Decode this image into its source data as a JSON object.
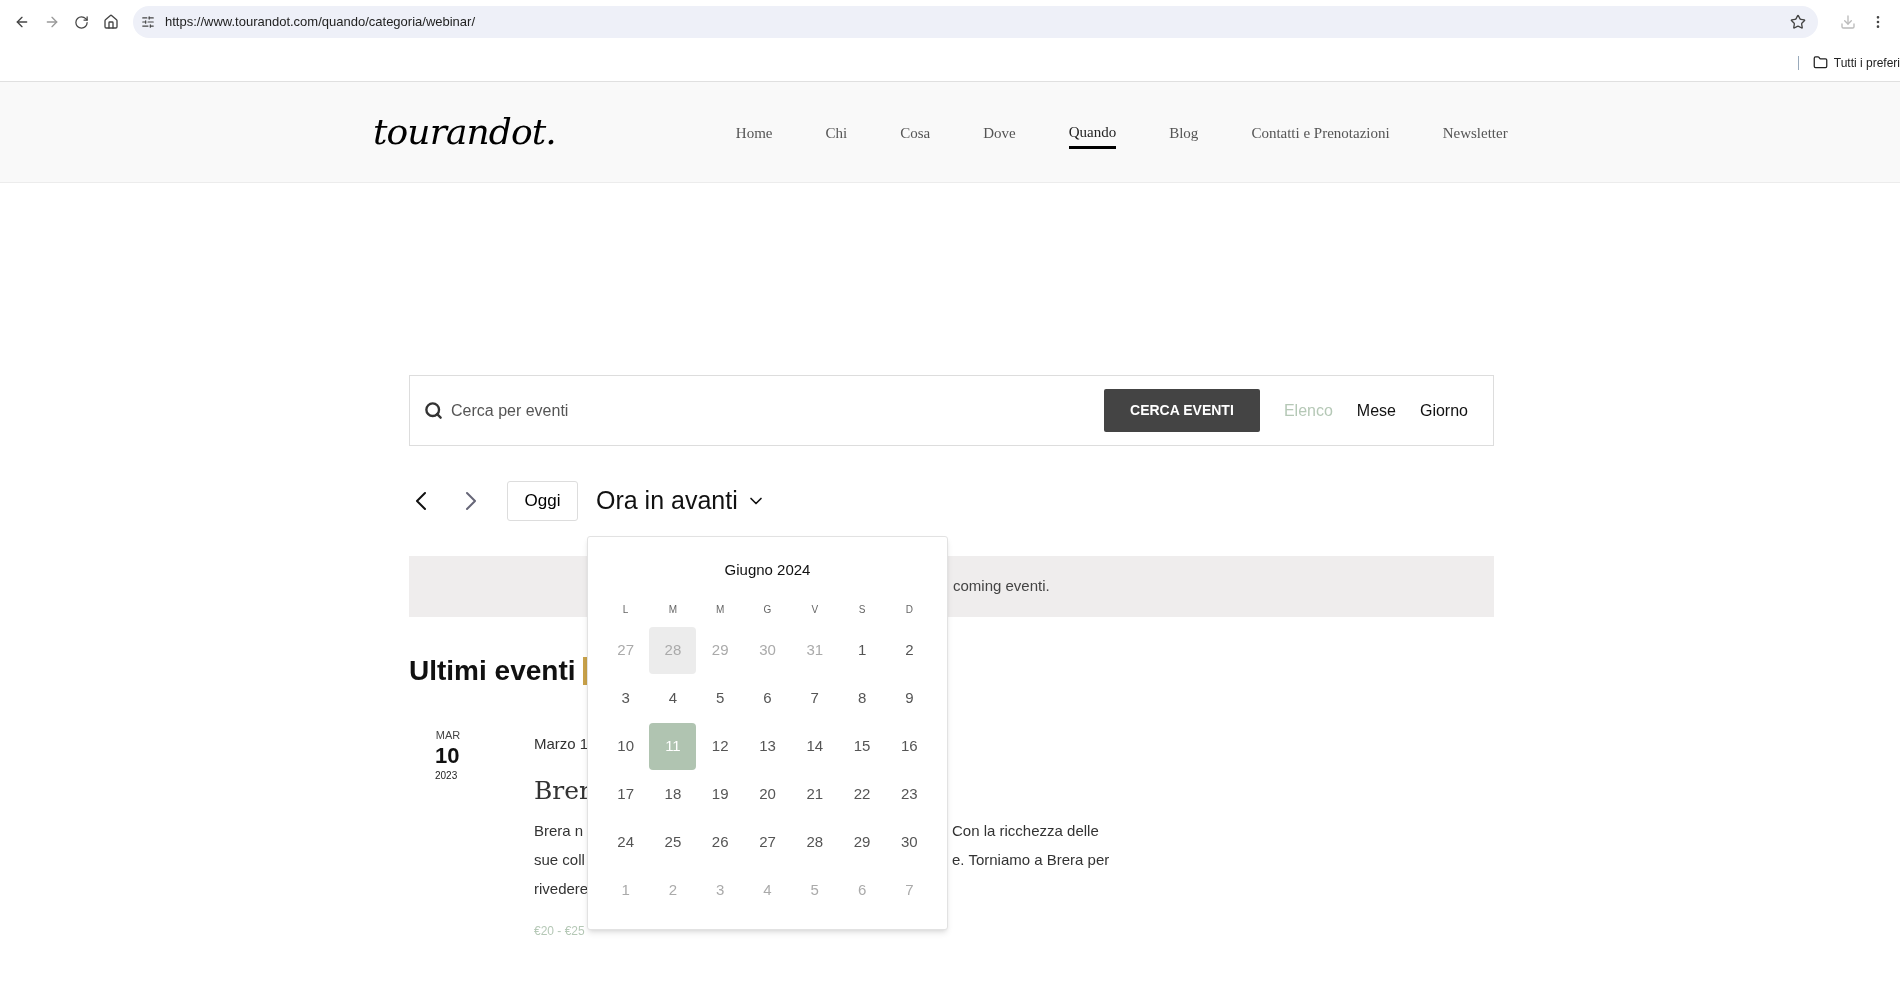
{
  "browser": {
    "url": "https://www.tourandot.com/quando/categoria/webinar/",
    "bookmarks_folder": "Tutti i preferi"
  },
  "header": {
    "logo": "tourandot.",
    "nav": [
      {
        "label": "Home",
        "selected": false
      },
      {
        "label": "Chi",
        "selected": false
      },
      {
        "label": "Cosa",
        "selected": false
      },
      {
        "label": "Dove",
        "selected": false
      },
      {
        "label": "Quando",
        "selected": true
      },
      {
        "label": "Blog",
        "selected": false
      },
      {
        "label": "Contatti e Prenotazioni",
        "selected": false
      },
      {
        "label": "Newsletter",
        "selected": false
      }
    ]
  },
  "search": {
    "placeholder": "Cerca per eventi",
    "button": "CERCA EVENTI",
    "views": [
      {
        "label": "Elenco",
        "selected": true
      },
      {
        "label": "Mese",
        "selected": false
      },
      {
        "label": "Giorno",
        "selected": false
      }
    ]
  },
  "toolbar": {
    "today": "Oggi",
    "range": "Ora in avanti"
  },
  "notice": "coming eventi.",
  "calendar": {
    "title": "Giugno 2024",
    "weekdays": [
      "L",
      "M",
      "M",
      "G",
      "V",
      "S",
      "D"
    ],
    "weeks": [
      [
        {
          "label": "27",
          "muted": true,
          "hovered": false,
          "selected": false
        },
        {
          "label": "28",
          "muted": true,
          "hovered": true,
          "selected": false
        },
        {
          "label": "29",
          "muted": true,
          "hovered": false,
          "selected": false
        },
        {
          "label": "30",
          "muted": true,
          "hovered": false,
          "selected": false
        },
        {
          "label": "31",
          "muted": true,
          "hovered": false,
          "selected": false
        },
        {
          "label": "1",
          "muted": false,
          "hovered": false,
          "selected": false
        },
        {
          "label": "2",
          "muted": false,
          "hovered": false,
          "selected": false
        }
      ],
      [
        {
          "label": "3",
          "muted": false,
          "hovered": false,
          "selected": false
        },
        {
          "label": "4",
          "muted": false,
          "hovered": false,
          "selected": false
        },
        {
          "label": "5",
          "muted": false,
          "hovered": false,
          "selected": false
        },
        {
          "label": "6",
          "muted": false,
          "hovered": false,
          "selected": false
        },
        {
          "label": "7",
          "muted": false,
          "hovered": false,
          "selected": false
        },
        {
          "label": "8",
          "muted": false,
          "hovered": false,
          "selected": false
        },
        {
          "label": "9",
          "muted": false,
          "hovered": false,
          "selected": false
        }
      ],
      [
        {
          "label": "10",
          "muted": false,
          "hovered": false,
          "selected": false
        },
        {
          "label": "11",
          "muted": false,
          "hovered": false,
          "selected": true
        },
        {
          "label": "12",
          "muted": false,
          "hovered": false,
          "selected": false
        },
        {
          "label": "13",
          "muted": false,
          "hovered": false,
          "selected": false
        },
        {
          "label": "14",
          "muted": false,
          "hovered": false,
          "selected": false
        },
        {
          "label": "15",
          "muted": false,
          "hovered": false,
          "selected": false
        },
        {
          "label": "16",
          "muted": false,
          "hovered": false,
          "selected": false
        }
      ],
      [
        {
          "label": "17",
          "muted": false,
          "hovered": false,
          "selected": false
        },
        {
          "label": "18",
          "muted": false,
          "hovered": false,
          "selected": false
        },
        {
          "label": "19",
          "muted": false,
          "hovered": false,
          "selected": false
        },
        {
          "label": "20",
          "muted": false,
          "hovered": false,
          "selected": false
        },
        {
          "label": "21",
          "muted": false,
          "hovered": false,
          "selected": false
        },
        {
          "label": "22",
          "muted": false,
          "hovered": false,
          "selected": false
        },
        {
          "label": "23",
          "muted": false,
          "hovered": false,
          "selected": false
        }
      ],
      [
        {
          "label": "24",
          "muted": false,
          "hovered": false,
          "selected": false
        },
        {
          "label": "25",
          "muted": false,
          "hovered": false,
          "selected": false
        },
        {
          "label": "26",
          "muted": false,
          "hovered": false,
          "selected": false
        },
        {
          "label": "27",
          "muted": false,
          "hovered": false,
          "selected": false
        },
        {
          "label": "28",
          "muted": false,
          "hovered": false,
          "selected": false
        },
        {
          "label": "29",
          "muted": false,
          "hovered": false,
          "selected": false
        },
        {
          "label": "30",
          "muted": false,
          "hovered": false,
          "selected": false
        }
      ],
      [
        {
          "label": "1",
          "muted": true,
          "hovered": false,
          "selected": false
        },
        {
          "label": "2",
          "muted": true,
          "hovered": false,
          "selected": false
        },
        {
          "label": "3",
          "muted": true,
          "hovered": false,
          "selected": false
        },
        {
          "label": "4",
          "muted": true,
          "hovered": false,
          "selected": false
        },
        {
          "label": "5",
          "muted": true,
          "hovered": false,
          "selected": false
        },
        {
          "label": "6",
          "muted": true,
          "hovered": false,
          "selected": false
        },
        {
          "label": "7",
          "muted": true,
          "hovered": false,
          "selected": false
        }
      ]
    ]
  },
  "section_title": "Ultimi eventi",
  "event": {
    "month": "MAR",
    "day": "10",
    "year": "2023",
    "date": "Marzo 1",
    "title": "Brer",
    "lines": [
      {
        "left": "Brera n",
        "right": "Con la ricchezza delle"
      },
      {
        "left": "sue coll",
        "right": "e. Torniamo a Brera per"
      },
      {
        "left": "rivedere"
      }
    ],
    "price": "€20 - €25"
  }
}
